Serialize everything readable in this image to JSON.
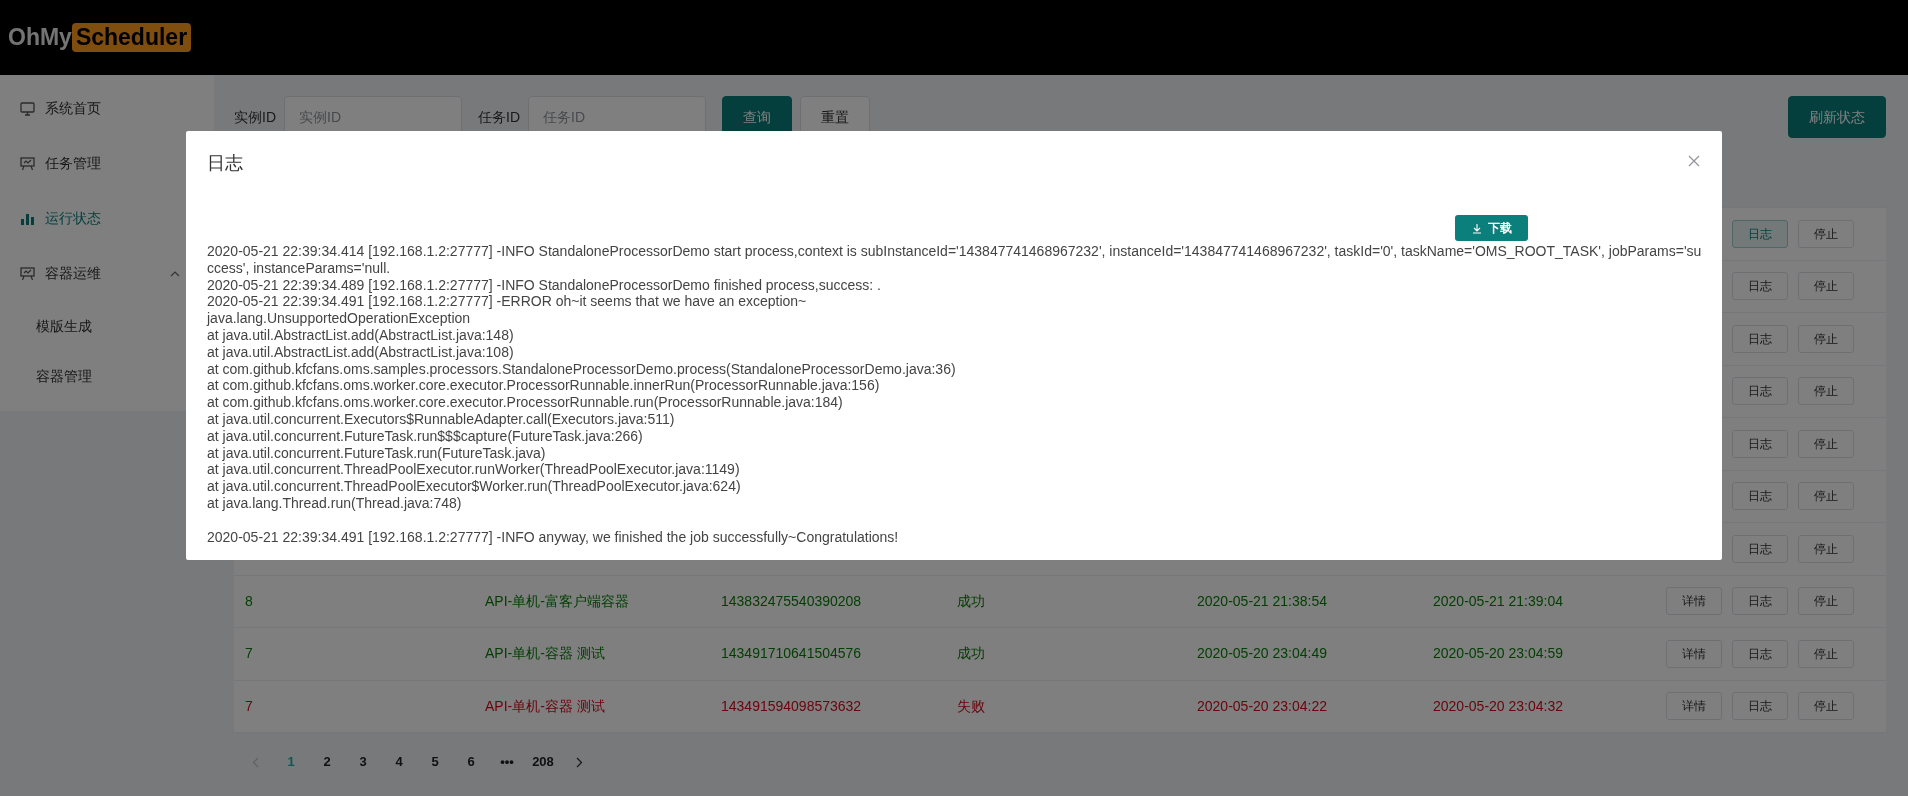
{
  "header": {
    "logo_text": "OhMy",
    "logo_badge": "Scheduler"
  },
  "sidebar": {
    "items": [
      {
        "label": "系统首页",
        "kind": "monitor",
        "selected": false
      },
      {
        "label": "任务管理",
        "kind": "board",
        "selected": false
      },
      {
        "label": "运行状态",
        "kind": "chart",
        "selected": true
      },
      {
        "label": "容器运维",
        "kind": "board",
        "selected": false,
        "expanded": true,
        "children": [
          {
            "label": "模版生成",
            "selected": false
          },
          {
            "label": "容器管理",
            "selected": false
          }
        ]
      }
    ]
  },
  "search": {
    "fields": [
      {
        "label": "实例ID",
        "placeholder": "实例ID"
      },
      {
        "label": "任务ID",
        "placeholder": "任务ID"
      }
    ],
    "query_button": "查询",
    "reset_button": "重置",
    "refresh_button": "刷新状态"
  },
  "table": {
    "rows": [
      {
        "actions": [
          {
            "label": "日志",
            "focused": true
          },
          {
            "label": "停止",
            "focused": false
          }
        ]
      },
      {
        "actions": [
          {
            "label": "日志",
            "focused": false
          },
          {
            "label": "停止",
            "focused": false
          }
        ]
      },
      {
        "actions": [
          {
            "label": "日志",
            "focused": false
          },
          {
            "label": "停止",
            "focused": false
          }
        ]
      },
      {
        "actions": [
          {
            "label": "日志",
            "focused": false
          },
          {
            "label": "停止",
            "focused": false
          }
        ]
      },
      {
        "actions": [
          {
            "label": "日志",
            "focused": false
          },
          {
            "label": "停止",
            "focused": false
          }
        ]
      },
      {
        "actions": [
          {
            "label": "日志",
            "focused": false
          },
          {
            "label": "停止",
            "focused": false
          }
        ]
      },
      {
        "actions": [
          {
            "label": "日志",
            "focused": false
          },
          {
            "label": "停止",
            "focused": false
          }
        ]
      },
      {
        "kind": "success",
        "job_id": "8",
        "job_name": "API-单机-富客户端容器",
        "instance_id": "143832475540390208",
        "status": "成功",
        "start_time": "2020-05-21 21:38:54",
        "end_time": "2020-05-21 21:39:04",
        "actions": [
          {
            "label": "详情",
            "focused": false
          },
          {
            "label": "日志",
            "focused": false
          },
          {
            "label": "停止",
            "focused": false
          }
        ]
      },
      {
        "kind": "success",
        "job_id": "7",
        "job_name": "API-单机-容器 测试",
        "instance_id": "143491710641504576",
        "status": "成功",
        "start_time": "2020-05-20 23:04:49",
        "end_time": "2020-05-20 23:04:59",
        "actions": [
          {
            "label": "详情",
            "focused": false
          },
          {
            "label": "日志",
            "focused": false
          },
          {
            "label": "停止",
            "focused": false
          }
        ]
      },
      {
        "kind": "failed",
        "job_id": "7",
        "job_name": "API-单机-容器 测试",
        "instance_id": "143491594098573632",
        "status": "失败",
        "start_time": "2020-05-20 23:04:22",
        "end_time": "2020-05-20 23:04:32",
        "actions": [
          {
            "label": "详情",
            "focused": false
          },
          {
            "label": "日志",
            "focused": false
          },
          {
            "label": "停止",
            "focused": false
          }
        ]
      }
    ]
  },
  "pagination": {
    "prev_disabled": true,
    "next_disabled": false,
    "items": [
      {
        "kind": "page",
        "label": "1",
        "selected": true
      },
      {
        "kind": "page",
        "label": "2",
        "selected": false
      },
      {
        "kind": "page",
        "label": "3",
        "selected": false
      },
      {
        "kind": "page",
        "label": "4",
        "selected": false
      },
      {
        "kind": "page",
        "label": "5",
        "selected": false
      },
      {
        "kind": "page",
        "label": "6",
        "selected": false
      },
      {
        "kind": "ellipsis",
        "label": "•••"
      },
      {
        "kind": "page",
        "label": "208",
        "selected": false
      }
    ]
  },
  "modal": {
    "title": "日志",
    "download_button": "下载",
    "log_blocks": [
      [
        "2020-05-21 22:39:34.414 [192.168.1.2:27777] -INFO StandaloneProcessorDemo start process,context is subInstanceId='143847741468967232', instanceId='143847741468967232', taskId='0', taskName='OMS_ROOT_TASK', jobParams='su",
        "ccess', instanceParams='null.",
        "2020-05-21 22:39:34.489 [192.168.1.2:27777] -INFO StandaloneProcessorDemo finished process,success: .",
        "2020-05-21 22:39:34.491 [192.168.1.2:27777] -ERROR oh~it seems that we have an exception~",
        "java.lang.UnsupportedOperationException",
        "at java.util.AbstractList.add(AbstractList.java:148)",
        "at java.util.AbstractList.add(AbstractList.java:108)",
        "at com.github.kfcfans.oms.samples.processors.StandaloneProcessorDemo.process(StandaloneProcessorDemo.java:36)",
        "at com.github.kfcfans.oms.worker.core.executor.ProcessorRunnable.innerRun(ProcessorRunnable.java:156)",
        "at com.github.kfcfans.oms.worker.core.executor.ProcessorRunnable.run(ProcessorRunnable.java:184)",
        "at java.util.concurrent.Executors$RunnableAdapter.call(Executors.java:511)",
        "at java.util.concurrent.FutureTask.run$$$capture(FutureTask.java:266)",
        "at java.util.concurrent.FutureTask.run(FutureTask.java)",
        "at java.util.concurrent.ThreadPoolExecutor.runWorker(ThreadPoolExecutor.java:1149)",
        "at java.util.concurrent.ThreadPoolExecutor$Worker.run(ThreadPoolExecutor.java:624)",
        "at java.lang.Thread.run(Thread.java:748)"
      ],
      [
        "2020-05-21 22:39:34.491 [192.168.1.2:27777] -INFO anyway, we finished the job successfully~Congratulations!"
      ]
    ]
  }
}
